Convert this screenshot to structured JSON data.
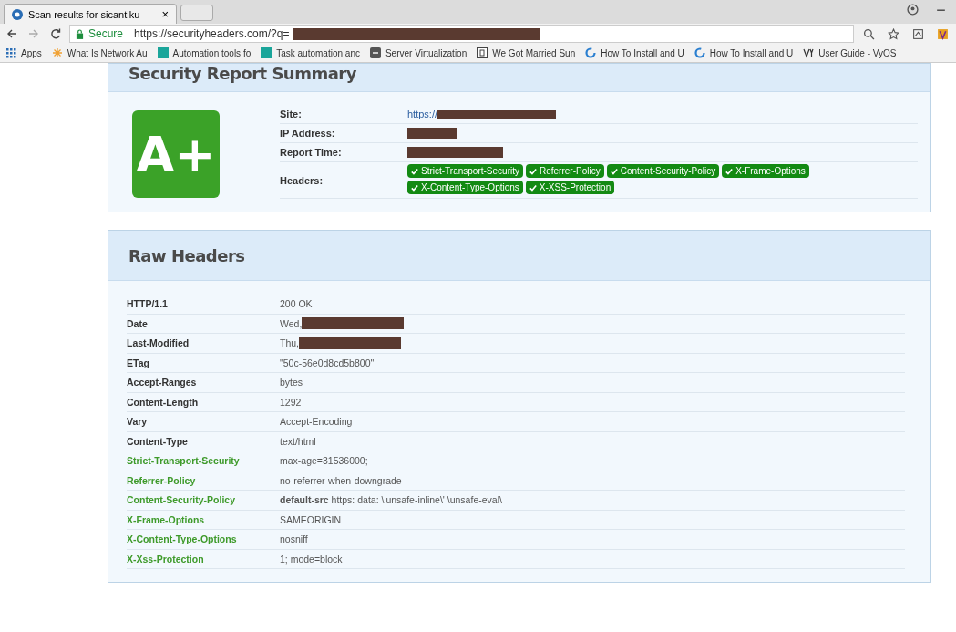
{
  "browser": {
    "tab_title": "Scan results for sicantiku",
    "tab_close": "×",
    "secure_label": "Secure",
    "url": "https://securityheaders.com/?q=",
    "url_redacted": true,
    "bookmarks": [
      {
        "label": "Apps",
        "kind": "grid"
      },
      {
        "label": "What Is Network Au",
        "kind": "star"
      },
      {
        "label": "Automation tools fo",
        "kind": "square"
      },
      {
        "label": "Task automation anc",
        "kind": "square"
      },
      {
        "label": "Server Virtualization",
        "kind": "vm"
      },
      {
        "label": "We Got Married Sun",
        "kind": "b"
      },
      {
        "label": "How To Install and U",
        "kind": "ring"
      },
      {
        "label": "How To Install and U",
        "kind": "ring"
      },
      {
        "label": "User Guide - VyOS",
        "kind": "vy"
      }
    ]
  },
  "summary": {
    "title": "Security Report Summary",
    "grade": "A+",
    "fields": [
      {
        "label": "Site:",
        "value": "https://",
        "kind": "link",
        "redacted": true
      },
      {
        "label": "IP Address:",
        "kind": "text",
        "redacted": true
      },
      {
        "label": "Report Time:",
        "kind": "text",
        "redacted": true
      },
      {
        "label": "Headers:",
        "kind": "badges",
        "badges": [
          "Strict-Transport-Security",
          "Referrer-Policy",
          "Content-Security-Policy",
          "X-Frame-Options",
          "X-Content-Type-Options",
          "X-XSS-Protection"
        ]
      }
    ]
  },
  "raw_headers": {
    "title": "Raw Headers",
    "rows": [
      {
        "name": "HTTP/1.1",
        "value": "200 OK",
        "highlight": false,
        "redacted": false
      },
      {
        "name": "Date",
        "value": "Wed,",
        "highlight": false,
        "redacted": true
      },
      {
        "name": "Last-Modified",
        "value": "Thu,",
        "highlight": false,
        "redacted": true
      },
      {
        "name": "ETag",
        "value": "\"50c-56e0d8cd5b800\"",
        "highlight": false,
        "redacted": false
      },
      {
        "name": "Accept-Ranges",
        "value": "bytes",
        "highlight": false,
        "redacted": false
      },
      {
        "name": "Content-Length",
        "value": "1292",
        "highlight": false,
        "redacted": false
      },
      {
        "name": "Vary",
        "value": "Accept-Encoding",
        "highlight": false,
        "redacted": false
      },
      {
        "name": "Content-Type",
        "value": "text/html",
        "highlight": false,
        "redacted": false
      },
      {
        "name": "Strict-Transport-Security",
        "value": "max-age=31536000;",
        "highlight": true,
        "redacted": false
      },
      {
        "name": "Referrer-Policy",
        "value": "no-referrer-when-downgrade",
        "highlight": true,
        "redacted": false
      },
      {
        "name": "Content-Security-Policy",
        "value": "**default-src** https: data: \\'unsafe-inline\\' \\unsafe-eval\\",
        "highlight": true,
        "redacted": false
      },
      {
        "name": "X-Frame-Options",
        "value": "SAMEORIGIN",
        "highlight": true,
        "redacted": false
      },
      {
        "name": "X-Content-Type-Options",
        "value": "nosniff",
        "highlight": true,
        "redacted": false
      },
      {
        "name": "X-Xss-Protection",
        "value": "1; mode=block",
        "highlight": true,
        "redacted": false
      }
    ]
  }
}
